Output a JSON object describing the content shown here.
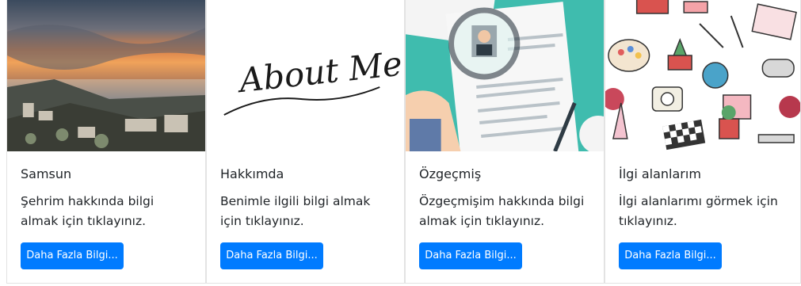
{
  "cards": [
    {
      "image_name": "samsun-city-sunset-image",
      "title": "Samsun",
      "text": "Şehrim hakkında bilgi almak için tıklayınız.",
      "button_label": "Daha Fazla Bilgi..."
    },
    {
      "image_name": "about-me-script-image",
      "image_text": "About Me",
      "title": "Hakkımda",
      "text": "Benimle ilgili bilgi almak için tıklayınız.",
      "button_label": "Daha Fazla Bilgi..."
    },
    {
      "image_name": "resume-magnifier-image",
      "title": "Özgeçmiş",
      "text": "Özgeçmişim hakkında bilgi almak için tıklayınız.",
      "button_label": "Daha Fazla Bilgi..."
    },
    {
      "image_name": "hobbies-illustration-image",
      "title": "İlgi alanlarım",
      "text": "İlgi alanlarımı görmek için tıklayınız.",
      "button_label": "Daha Fazla Bilgi..."
    }
  ],
  "colors": {
    "button_bg": "#007bff",
    "button_text": "#ffffff",
    "card_border": "#e3e3e3",
    "text": "#212529"
  }
}
